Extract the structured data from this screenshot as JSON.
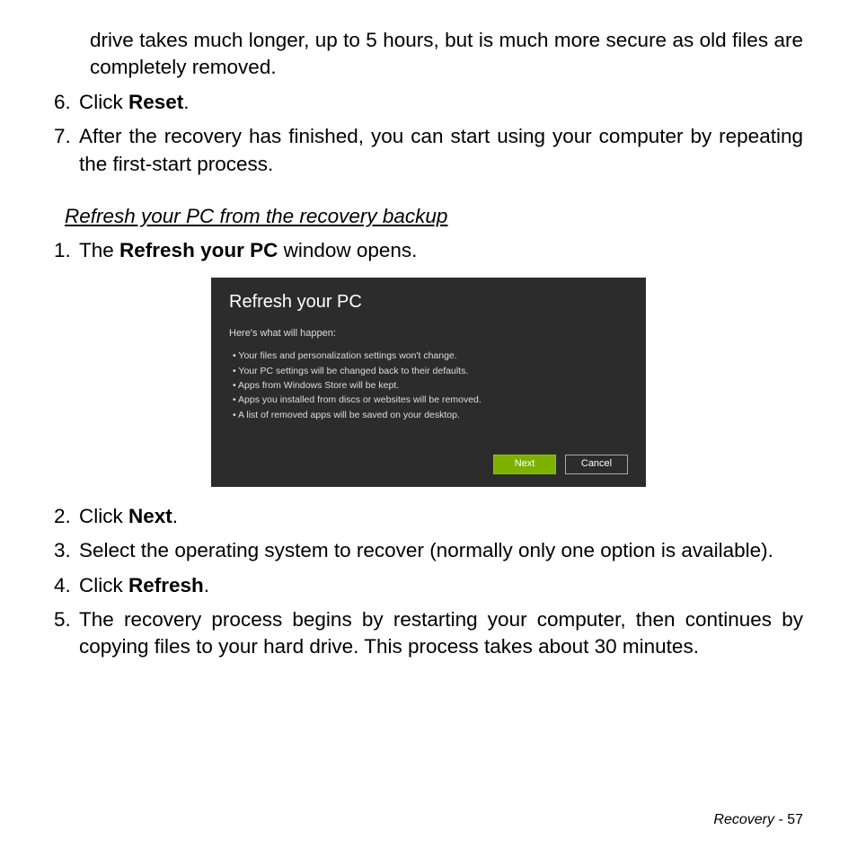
{
  "continuation_para": "drive takes much longer, up to 5 hours, but is much more secure as old files are completely removed.",
  "top_list": [
    {
      "num": "6.",
      "pre": "Click ",
      "bold": "Reset",
      "post": "."
    },
    {
      "num": "7.",
      "text": "After the recovery has finished, you can start using your computer by repeating the first-start process."
    }
  ],
  "heading": "Refresh your PC from the recovery backup",
  "step1": {
    "num": "1.",
    "pre": "The ",
    "bold": "Refresh your PC",
    "post": " window opens."
  },
  "dialog": {
    "title": "Refresh your PC",
    "subtitle": "Here's what will happen:",
    "items": [
      "Your files and personalization settings won't change.",
      "Your PC settings will be changed back to their defaults.",
      "Apps from Windows Store will be kept.",
      "Apps you installed from discs or websites will be removed.",
      "A list of removed apps will be saved on your desktop."
    ],
    "next": "Next",
    "cancel": "Cancel"
  },
  "post_list": [
    {
      "num": "2.",
      "pre": "Click ",
      "bold": "Next",
      "post": "."
    },
    {
      "num": "3.",
      "text": "Select the operating system to recover (normally only one option is available)."
    },
    {
      "num": "4.",
      "pre": "Click ",
      "bold": "Refresh",
      "post": "."
    },
    {
      "num": "5.",
      "text": "The recovery process begins by restarting your computer, then continues by copying files to your hard drive. This process takes about 30 minutes."
    }
  ],
  "footer": {
    "section": "Recovery -  ",
    "page": "57"
  }
}
